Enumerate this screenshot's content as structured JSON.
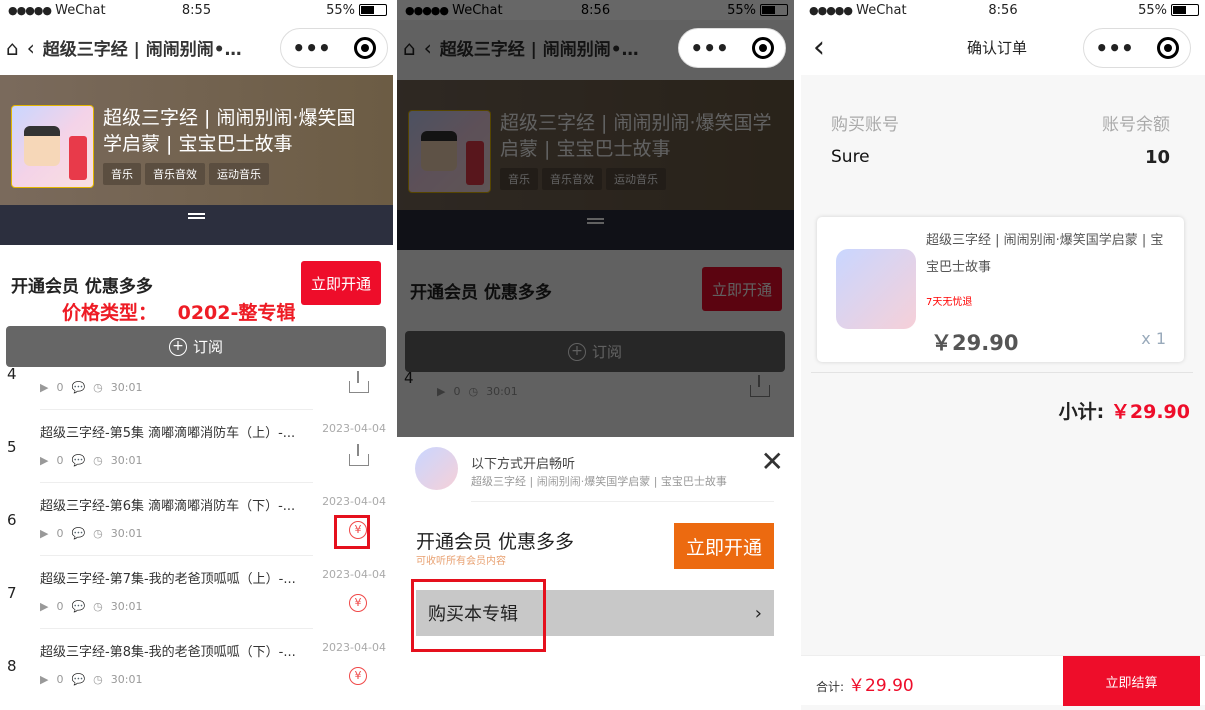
{
  "status": {
    "carrier": "WeChat",
    "signal": "●●●●●",
    "battery": "55%",
    "times": [
      "8:55",
      "8:56",
      "8:56"
    ]
  },
  "album": {
    "title": "超级三字经 | 闹闹别闹•爆笑国学启蒙 | 宝宝巴士故事",
    "title_full": "超级三字经 | 闹闹别闹·爆笑国学启蒙 | 宝宝巴士故事",
    "tags": [
      "音乐",
      "音乐音效",
      "运动音乐"
    ]
  },
  "capsule": {
    "more": "•••"
  },
  "member": {
    "text": "开通会员 优惠多多",
    "button": "立即开通",
    "sub": "可收听所有会员内容"
  },
  "annotation": {
    "price_type": "价格类型：  0202-整专辑"
  },
  "subscribe_label": "订阅",
  "episodes": [
    {
      "num": "4",
      "title": "",
      "plays": "0",
      "duration": "30:01",
      "date": "",
      "action": "download"
    },
    {
      "num": "5",
      "title": "超级三字经-第5集 滴嘟滴嘟消防车（上）-...",
      "plays": "0",
      "duration": "30:01",
      "date": "2023-04-04",
      "action": "download"
    },
    {
      "num": "6",
      "title": "超级三字经-第6集 滴嘟滴嘟消防车（下）-...",
      "plays": "0",
      "duration": "30:01",
      "date": "2023-04-04",
      "action": "pay"
    },
    {
      "num": "7",
      "title": "超级三字经-第7集-我的老爸顶呱呱（上）-...",
      "plays": "0",
      "duration": "30:01",
      "date": "2023-04-04",
      "action": "pay"
    },
    {
      "num": "8",
      "title": "超级三字经-第8集-我的老爸顶呱呱（下）-...",
      "plays": "0",
      "duration": "30:01",
      "date": "2023-04-04",
      "action": "pay"
    }
  ],
  "sheet": {
    "title": "以下方式开启畅听",
    "subtitle": "超级三字经 | 闹闹别闹·爆笑国学启蒙 | 宝宝巴士故事",
    "buy_album": "购买本专辑"
  },
  "order": {
    "page_title": "确认订单",
    "account_label": "购买账号",
    "balance_label": "账号余额",
    "account": "Sure",
    "balance": "10",
    "item_name": "超级三字经 | 闹闹别闹·爆笑国学启蒙 | 宝宝巴士故事",
    "item_tag": "7天无忧退",
    "price": "￥29.90",
    "qty": "x 1",
    "subtotal_label": "小计:",
    "subtotal": "￥29.90",
    "total_label": "合计:",
    "total": "￥29.90",
    "pay_button": "立即结算"
  }
}
